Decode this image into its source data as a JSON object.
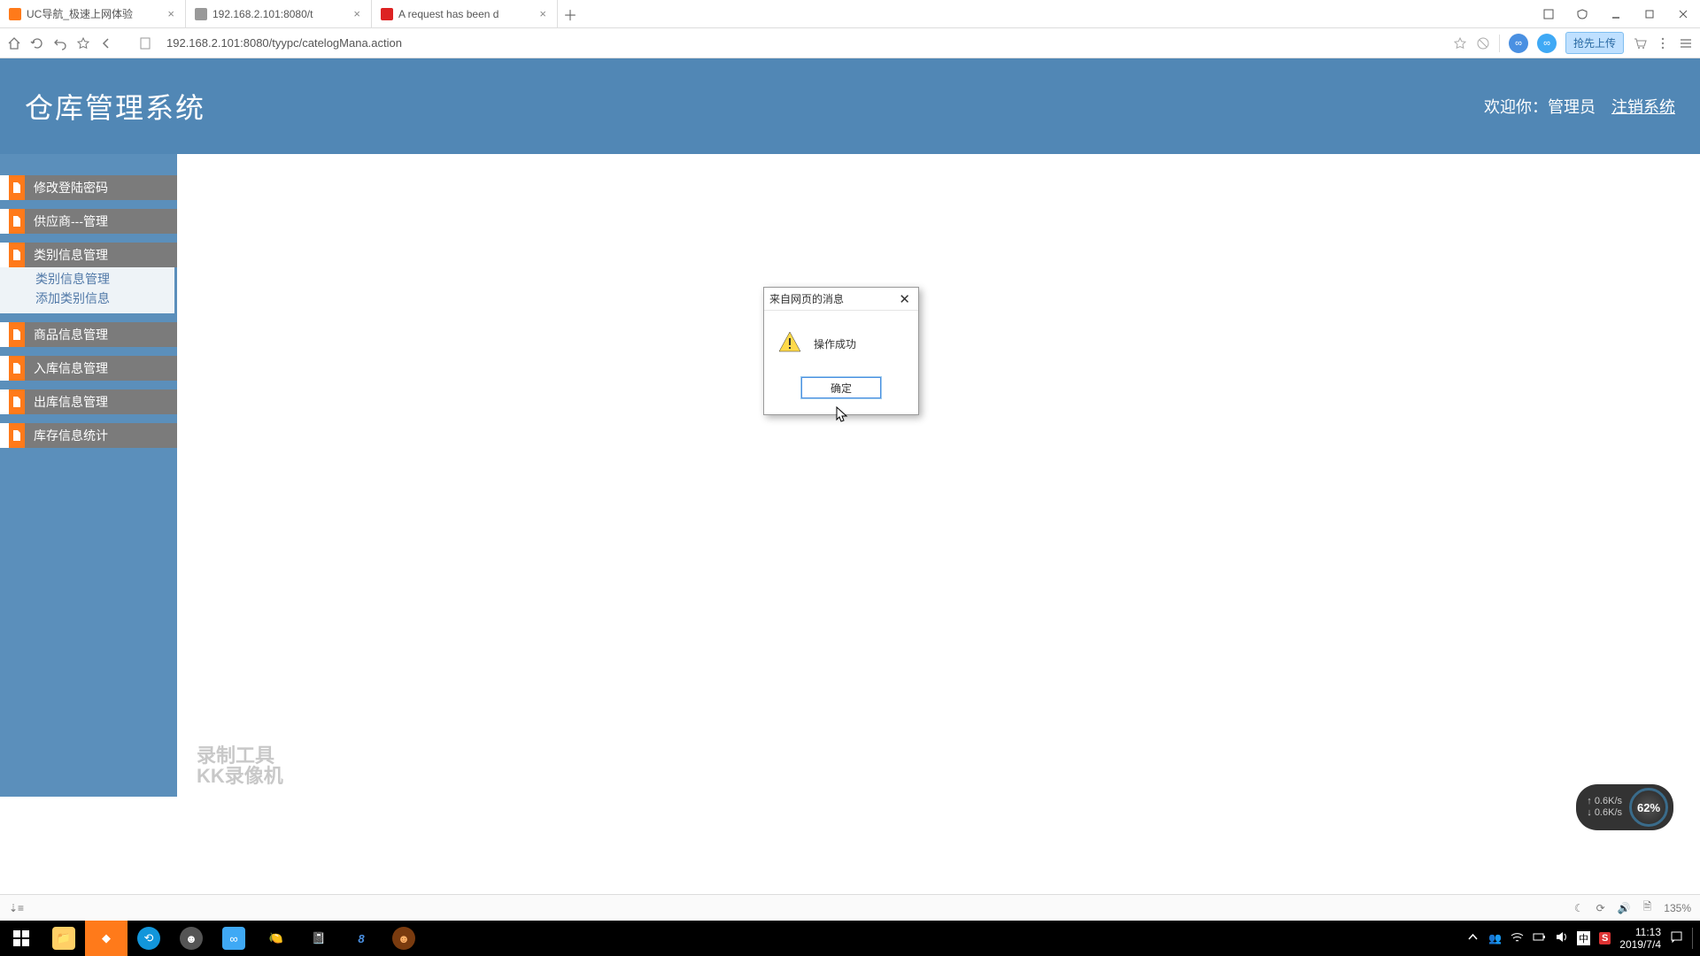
{
  "browser": {
    "tabs": [
      {
        "label": "UC导航_极速上网体验"
      },
      {
        "label": "192.168.2.101:8080/t"
      },
      {
        "label": "A request has been d"
      }
    ],
    "url": "192.168.2.101:8080/tyypc/catelogMana.action",
    "upload_btn": "抢先上传",
    "zoom": "135%"
  },
  "app": {
    "title": "仓库管理系统",
    "welcome_prefix": "欢迎你：",
    "user": "管理员",
    "logout": "注销系统"
  },
  "sidebar": {
    "items": [
      {
        "label": "修改登陆密码"
      },
      {
        "label": "供应商---管理"
      },
      {
        "label": "类别信息管理"
      },
      {
        "label": "商品信息管理"
      },
      {
        "label": "入库信息管理"
      },
      {
        "label": "出库信息管理"
      },
      {
        "label": "库存信息统计"
      }
    ],
    "sub_category": [
      "类别信息管理",
      "添加类别信息"
    ]
  },
  "dialog": {
    "title": "来自网页的消息",
    "message": "操作成功",
    "ok": "确定"
  },
  "watermark": {
    "line1": "录制工具",
    "line2": "KK录像机"
  },
  "speed": {
    "up": "0.6K/s",
    "down": "0.6K/s",
    "pct": "62%"
  },
  "tray": {
    "ime": "中",
    "sogou": "S",
    "time": "11:13",
    "date": "2019/7/4"
  },
  "status": {
    "sun": "☼",
    "moon": "☾",
    "volume": "🔊",
    "doc": "🗎"
  }
}
